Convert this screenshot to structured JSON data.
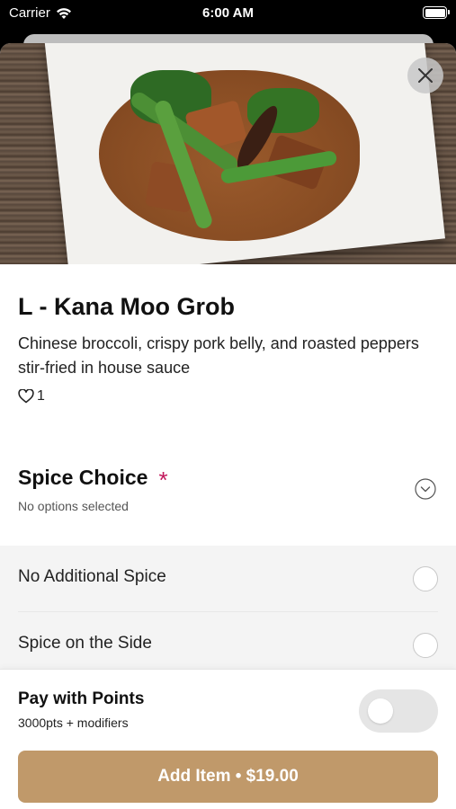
{
  "status_bar": {
    "carrier": "Carrier",
    "time": "6:00 AM"
  },
  "hero_image": {
    "description_icon": "food-photo"
  },
  "item": {
    "title": "L - Kana Moo Grob",
    "description": "Chinese broccoli, crispy pork belly, and roasted peppers stir-fried in house sauce",
    "likes_count": "1"
  },
  "modifier_group": {
    "title": "Spice Choice",
    "required_mark": "*",
    "status": "No options selected",
    "options": [
      {
        "label": "No Additional Spice"
      },
      {
        "label": "Spice on the Side"
      }
    ]
  },
  "footer": {
    "points_title": "Pay with Points",
    "points_subtitle": "3000pts + modifiers",
    "points_toggle_on": false,
    "add_button_label": "Add Item • $19.00"
  },
  "colors": {
    "accent": "#c0996a",
    "required": "#c2185b",
    "option_bg": "#f4f4f4"
  }
}
